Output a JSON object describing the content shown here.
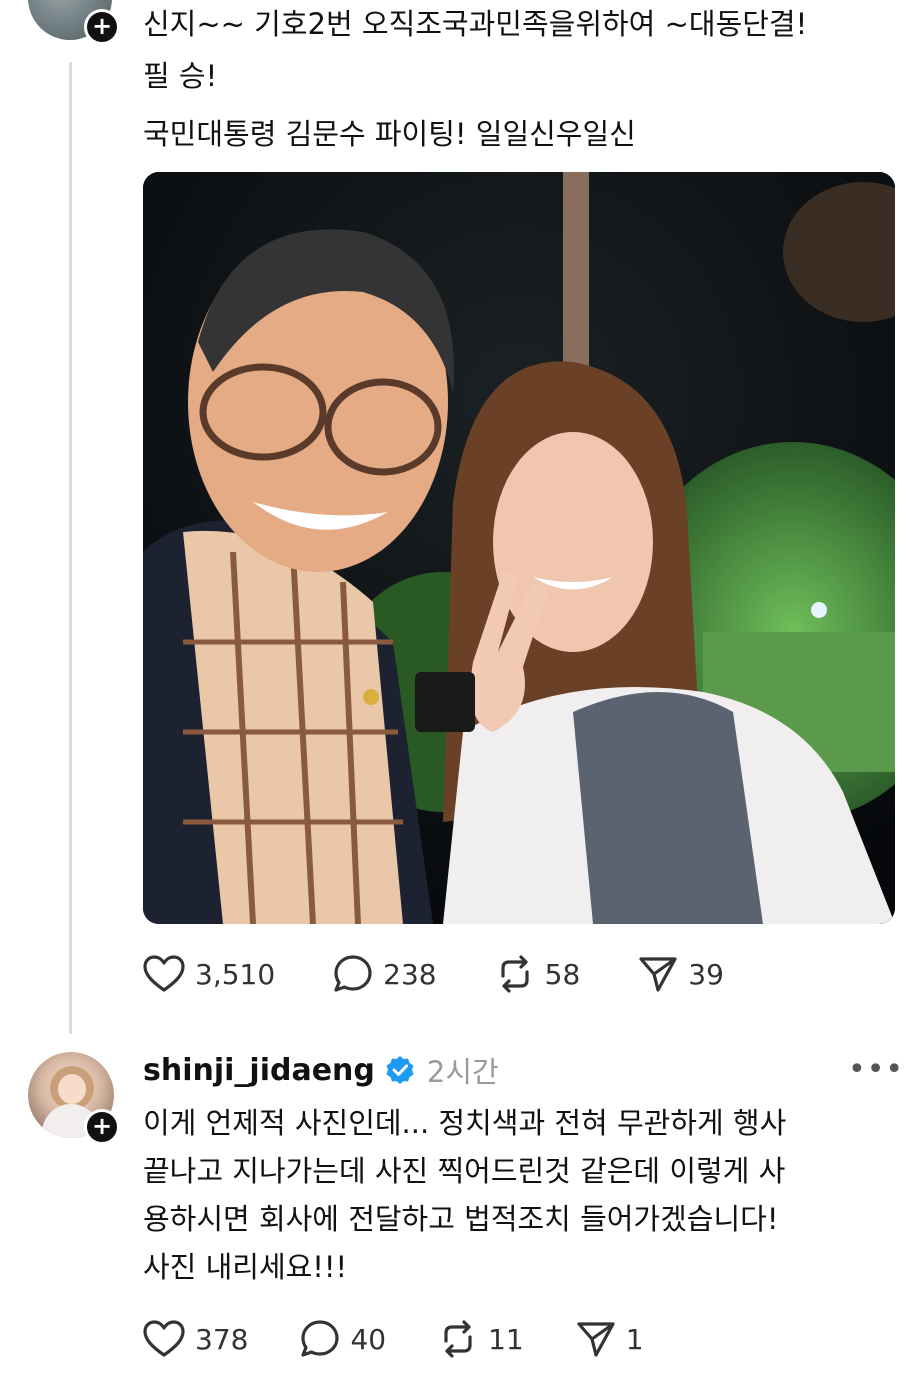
{
  "post1": {
    "lines": [
      "신지~~ 기호2번  오직조국과민족을위하여 ~대동단결!",
      "필 승!",
      "국민대통령 김문수 파이팅! 일일신우일신"
    ],
    "actions": {
      "likes": "3,510",
      "replies": "238",
      "reposts": "58",
      "shares": "39"
    }
  },
  "post2": {
    "username": "shinji_jidaeng",
    "time": "2시간",
    "more": "•••",
    "lines": [
      "이게 언제적 사진인데... 정치색과 전혀 무관하게 행사",
      "끝나고 지나가는데 사진 찍어드린것 같은데 이렇게 사",
      "용하시면 회사에 전달하고 법적조치 들어가겠습니다!",
      "사진 내리세요!!!"
    ],
    "actions": {
      "likes": "378",
      "replies": "40",
      "reposts": "11",
      "shares": "1"
    }
  },
  "colors": {
    "verified": "#1d9bf0",
    "text": "#111111",
    "muted": "#9a9a9a"
  },
  "icons": [
    "heart-icon",
    "comment-icon",
    "repost-icon",
    "share-icon",
    "verified-badge-icon",
    "plus-icon",
    "more-icon"
  ]
}
